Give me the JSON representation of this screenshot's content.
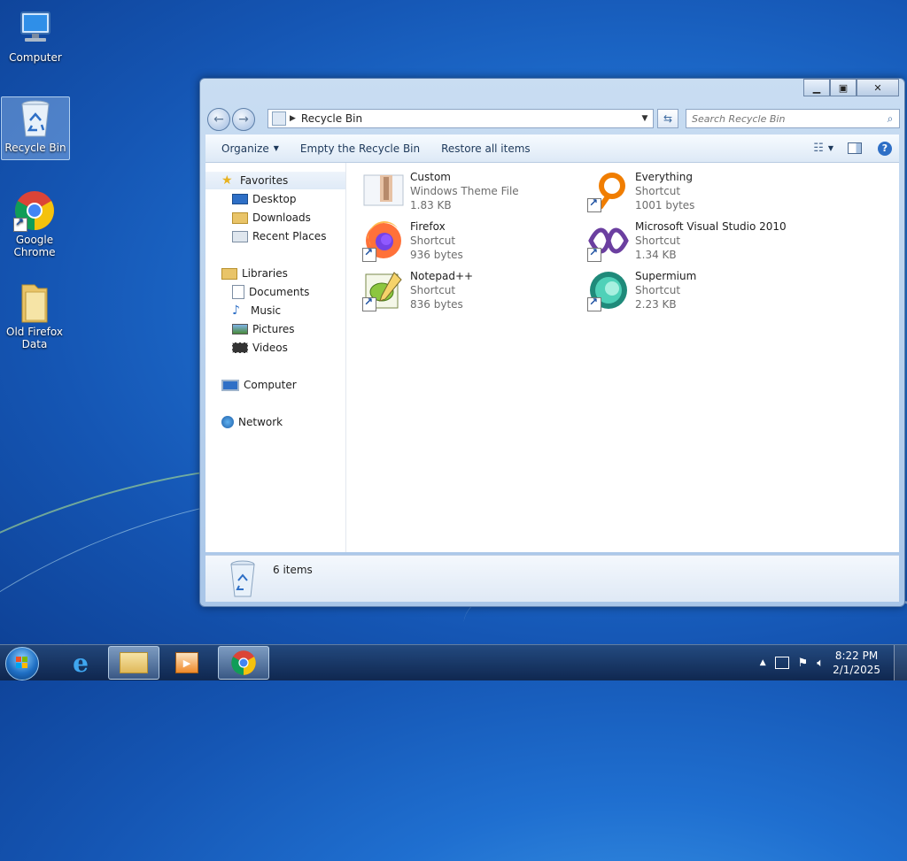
{
  "desktop": {
    "icons": [
      {
        "label": "Computer"
      },
      {
        "label": "Recycle Bin"
      },
      {
        "label": "Google Chrome"
      },
      {
        "label": "Old Firefox Data"
      }
    ]
  },
  "window": {
    "address": {
      "path": "Recycle Bin"
    },
    "search": {
      "placeholder": "Search Recycle Bin"
    },
    "toolbar": {
      "organize": "Organize",
      "empty": "Empty the Recycle Bin",
      "restore": "Restore all items"
    },
    "navpane": {
      "favorites": "Favorites",
      "favorites_items": [
        "Desktop",
        "Downloads",
        "Recent Places"
      ],
      "libraries": "Libraries",
      "libraries_items": [
        "Documents",
        "Music",
        "Pictures",
        "Videos"
      ],
      "computer": "Computer",
      "network": "Network"
    },
    "files": [
      {
        "name": "Custom",
        "type": "Windows Theme File",
        "size": "1.83 KB",
        "icon": "theme-file-icon"
      },
      {
        "name": "Everything",
        "type": "Shortcut",
        "size": "1001 bytes",
        "icon": "everything-icon"
      },
      {
        "name": "Firefox",
        "type": "Shortcut",
        "size": "936 bytes",
        "icon": "firefox-icon"
      },
      {
        "name": "Microsoft Visual Studio 2010",
        "type": "Shortcut",
        "size": "1.34 KB",
        "icon": "visual-studio-icon"
      },
      {
        "name": "Notepad++",
        "type": "Shortcut",
        "size": "836 bytes",
        "icon": "notepad-plus-plus-icon"
      },
      {
        "name": "Supermium",
        "type": "Shortcut",
        "size": "2.23 KB",
        "icon": "supermium-icon"
      }
    ],
    "status": {
      "count": "6 items"
    }
  },
  "taskbar": {
    "clock": {
      "time": "8:22 PM",
      "date": "2/1/2025"
    }
  },
  "colors": {
    "selection": "#cfe3fb",
    "window_frame": "#a9c6e8",
    "link_text": "#1e395b"
  }
}
